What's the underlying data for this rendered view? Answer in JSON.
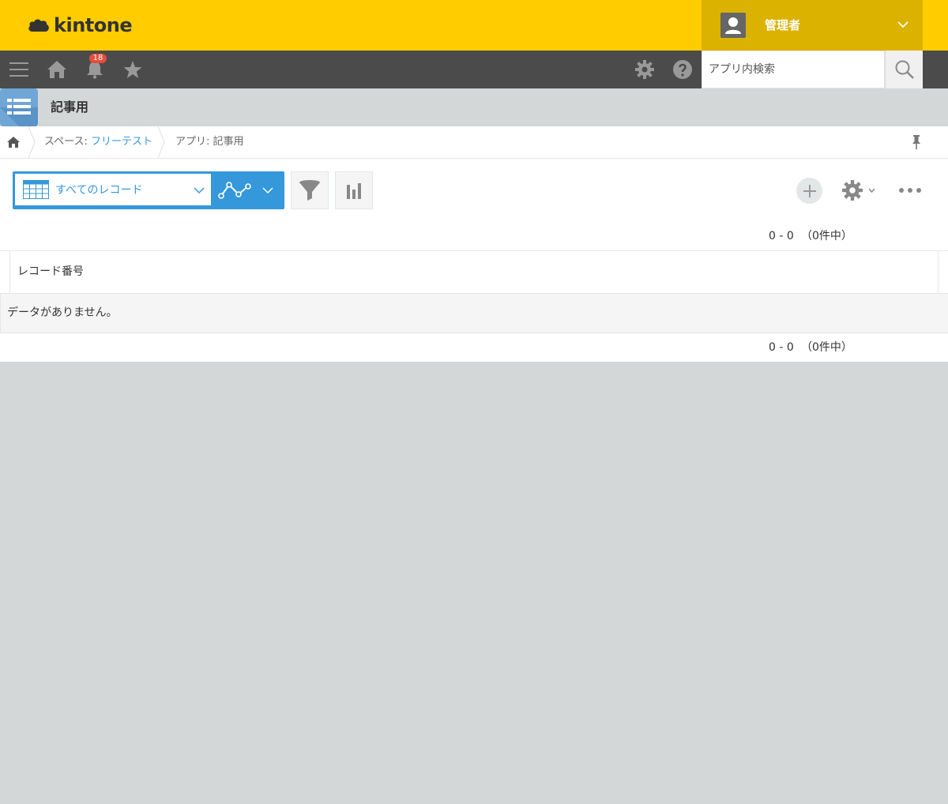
{
  "header": {
    "logo_text": "kintone",
    "user_name": "管理者",
    "brand_color": "#ffcc00"
  },
  "navbar": {
    "notification_count": "18",
    "search_placeholder": "アプリ内検索",
    "icons": [
      "menu-icon",
      "home-icon",
      "bell-icon",
      "star-icon",
      "gear-icon",
      "help-icon",
      "search-icon"
    ]
  },
  "app": {
    "name": "記事用"
  },
  "breadcrumb": {
    "space_prefix": "スペース: ",
    "space_name": "フリーテスト",
    "app_label": "アプリ: 記事用"
  },
  "toolbar": {
    "view_label": "すべてのレコード"
  },
  "pager": {
    "range": "0 - 0",
    "total": "（0件中）"
  },
  "table": {
    "columns": [
      "レコード番号"
    ],
    "empty_message": "データがありません。"
  },
  "colors": {
    "accent": "#3498db",
    "nav_bg": "#4b4b4b",
    "page_bg": "#d4d7d8"
  }
}
